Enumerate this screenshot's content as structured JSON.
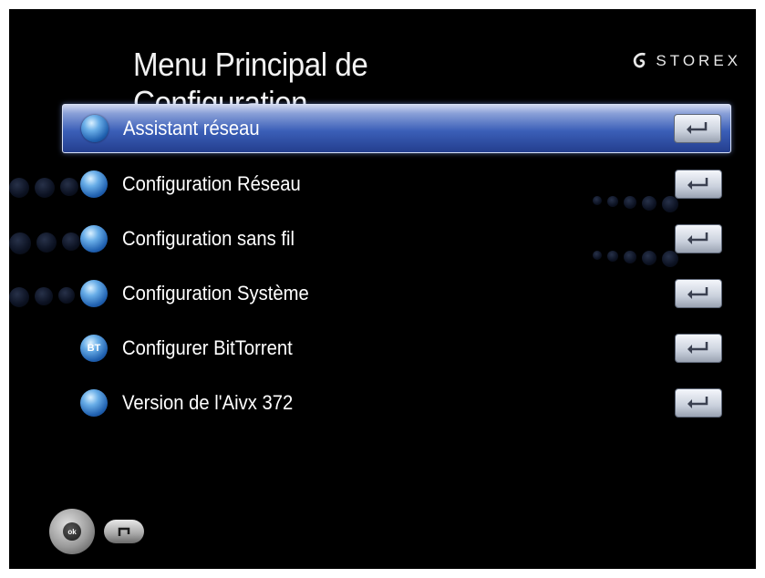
{
  "header": {
    "title": "Menu Principal de Configuration",
    "brand": "STOREX"
  },
  "menu": {
    "items": [
      {
        "label": "Assistant réseau",
        "icon": "network-wizard-icon",
        "selected": true
      },
      {
        "label": "Configuration Réseau",
        "icon": "network-config-icon",
        "selected": false
      },
      {
        "label": "Configuration sans fil",
        "icon": "wireless-config-icon",
        "selected": false
      },
      {
        "label": "Configuration Système",
        "icon": "system-config-icon",
        "selected": false
      },
      {
        "label": "Configurer BitTorrent",
        "icon": "bittorrent-icon",
        "selected": false,
        "badge": "BT"
      },
      {
        "label": "Version de l'Aivx 372",
        "icon": "version-info-icon",
        "selected": false
      }
    ]
  },
  "footer": {
    "ok_label": "ok"
  },
  "colors": {
    "background": "#000000",
    "selection": "#3b5fb8",
    "text": "#ffffff"
  }
}
